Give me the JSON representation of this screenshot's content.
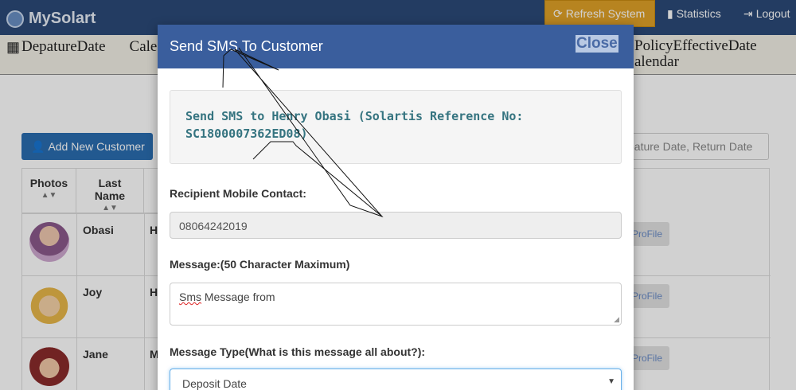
{
  "navbar": {
    "brand": "MySolart",
    "refresh_label": "Refresh System",
    "statistics_label": "Statistics",
    "logout_label": "Logout"
  },
  "date_strip": {
    "left_label": "DepatureDate",
    "left_label_2": "Cale",
    "right_label_1": "PolicyEffectiveDate",
    "right_label_2": "alendar"
  },
  "toolbar": {
    "add_customer_label": "Add New Customer",
    "search_placeholder": "pature Date, Return Date"
  },
  "table": {
    "headers": {
      "photos": "Photos",
      "last_name_1": "Last",
      "last_name_2": "Name"
    },
    "rows": [
      {
        "last_name": "Obasi",
        "initial": "H",
        "profile_label": "ProFile"
      },
      {
        "last_name": "Joy",
        "initial": "H",
        "profile_label": "ProFile"
      },
      {
        "last_name": "Jane",
        "initial": "M",
        "profile_label": "ProFile"
      }
    ]
  },
  "modal": {
    "title": "Send SMS To Customer",
    "close_label": "Close",
    "info_text": "Send SMS to Henry Obasi (Solartis Reference No: SC1800007362ED08)",
    "recipient_label": "Recipient Mobile Contact:",
    "recipient_value": "08064242019",
    "message_label": "Message:(50 Character Maximum)",
    "message_word_1": "Sms",
    "message_rest": " Message from",
    "type_label": "Message Type(What is this message all about?):",
    "type_selected": "Deposit Date"
  },
  "colors": {
    "navbar": "#2b4a78",
    "modal_header": "#3a5e9d",
    "refresh_button": "#e0a128",
    "add_button": "#2a6db0",
    "info_text": "#357480"
  }
}
